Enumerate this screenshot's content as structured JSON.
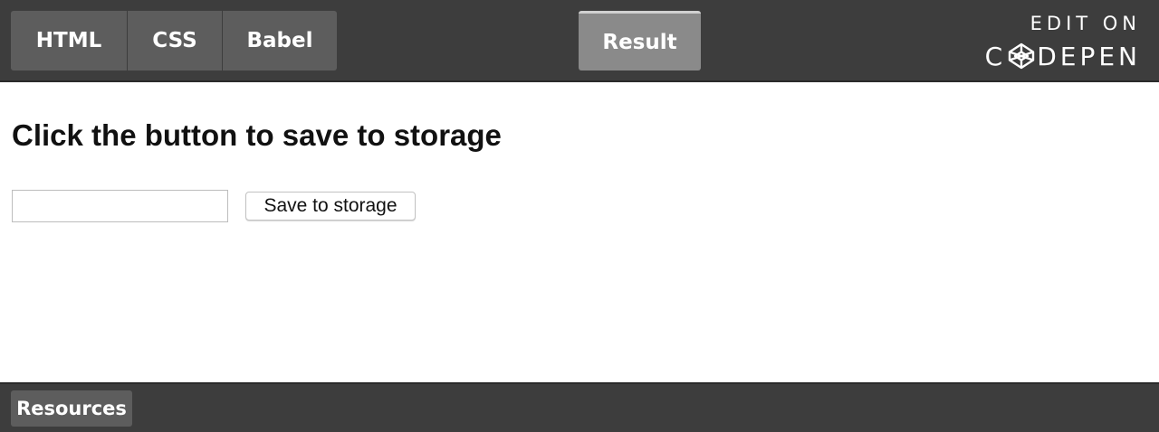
{
  "header": {
    "tabs": [
      {
        "label": "HTML"
      },
      {
        "label": "CSS"
      },
      {
        "label": "Babel"
      }
    ],
    "result_tab_label": "Result",
    "codepen_link": {
      "edit_on": "EDIT ON",
      "brand_before": "C",
      "brand_after": "DEPEN",
      "icon": "codepen-logo-icon"
    }
  },
  "main": {
    "heading": "Click the button to save to storage",
    "input": {
      "value": "",
      "placeholder": ""
    },
    "save_button_label": "Save to storage"
  },
  "footer": {
    "resources_label": "Resources"
  },
  "colors": {
    "bar_background": "#3d3d3d",
    "tab_background": "#5d5d5d",
    "active_tab_background": "#8a8a8a",
    "content_background": "#ffffff"
  }
}
